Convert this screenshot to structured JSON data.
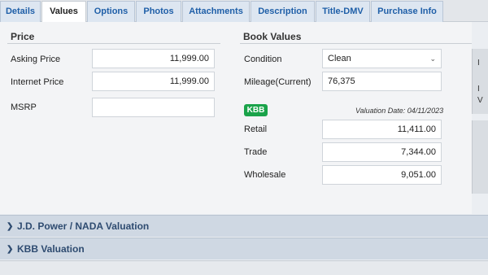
{
  "tabs": [
    {
      "label": "Details"
    },
    {
      "label": "Values"
    },
    {
      "label": "Options"
    },
    {
      "label": "Photos"
    },
    {
      "label": "Attachments"
    },
    {
      "label": "Description"
    },
    {
      "label": "Title-DMV"
    },
    {
      "label": "Purchase Info"
    }
  ],
  "active_tab": "Values",
  "price": {
    "title": "Price",
    "asking_label": "Asking Price",
    "asking_value": "11,999.00",
    "internet_label": "Internet Price",
    "internet_value": "11,999.00",
    "msrp_label": "MSRP",
    "msrp_value": ""
  },
  "book": {
    "title": "Book Values",
    "condition_label": "Condition",
    "condition_value": "Clean",
    "mileage_label": "Mileage",
    "mileage_suffix": "(Current)",
    "mileage_value": "76,375",
    "kbb_badge": "KBB",
    "valuation_date": "Valuation Date: 04/11/2023",
    "retail_label": "Retail",
    "retail_value": "11,411.00",
    "trade_label": "Trade",
    "trade_value": "7,344.00",
    "wholesale_label": "Wholesale",
    "wholesale_value": "9,051.00"
  },
  "side": {
    "char1": "I",
    "char2": "I",
    "char3": "V"
  },
  "sections": [
    {
      "label": "J.D. Power / NADA Valuation",
      "icon": "chevron-right-icon"
    },
    {
      "label": "KBB Valuation",
      "icon": "chevron-right-icon"
    }
  ],
  "colors": {
    "tab_text": "#1f5fa8",
    "kbb_green": "#1aa34a",
    "section_bar": "#cfd8e3"
  }
}
